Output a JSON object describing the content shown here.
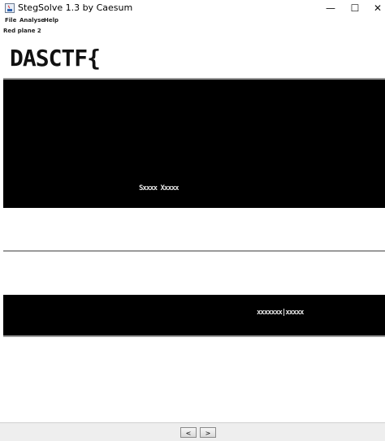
{
  "window": {
    "title": "StegSolve 1.3 by Caesum",
    "minimize": "—",
    "maximize": "☐",
    "close": "✕"
  },
  "menu": [
    "File",
    "Analyse",
    "Help"
  ],
  "plane_label": "Red plane 2",
  "image": {
    "top_text": "DASCTF{",
    "middle_text": "Sxxxx Xxxxx",
    "lower_text": "xxxxxxx|xxxxx"
  },
  "nav": {
    "prev": "<",
    "next": ">"
  },
  "colors": {
    "background": "#ffffff",
    "image_black": "#000000",
    "separator": "#9a9a9a"
  },
  "icons": [
    "java-app-icon",
    "minimize-icon",
    "maximize-icon",
    "close-icon"
  ]
}
